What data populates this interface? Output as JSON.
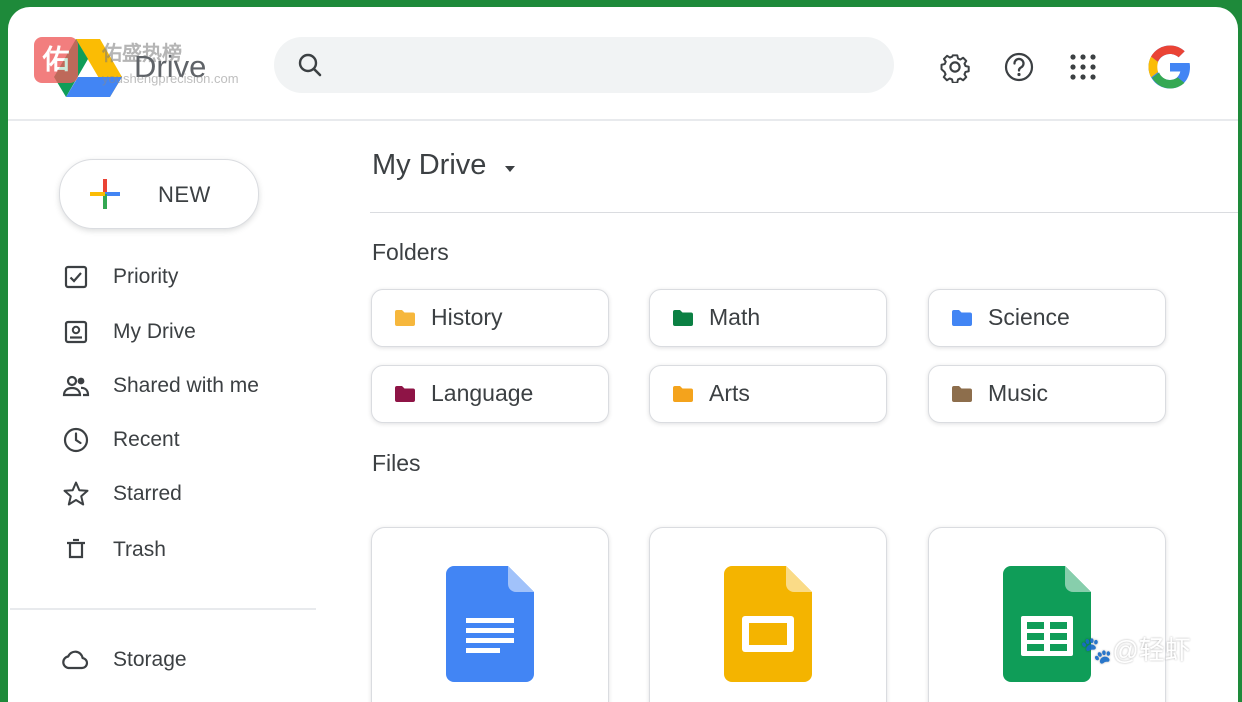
{
  "app": {
    "name": "Drive"
  },
  "watermark": {
    "badge": "佑",
    "title": "佑盛热榜",
    "url": "youshengprecision.com",
    "corner": "🐾@轻虾"
  },
  "search": {
    "placeholder": "",
    "value": ""
  },
  "header_icons": [
    "settings-gear-icon",
    "help-icon",
    "apps-grid-icon",
    "google-account-icon"
  ],
  "new_button": {
    "label": "NEW"
  },
  "nav": {
    "items": [
      {
        "label": "Priority",
        "icon": "priority-checkbox-icon"
      },
      {
        "label": "My Drive",
        "icon": "my-drive-icon"
      },
      {
        "label": "Shared with me",
        "icon": "shared-people-icon"
      },
      {
        "label": "Recent",
        "icon": "clock-icon"
      },
      {
        "label": "Starred",
        "icon": "star-icon"
      },
      {
        "label": "Trash",
        "icon": "trash-icon"
      }
    ],
    "storage": {
      "label": "Storage",
      "icon": "cloud-icon"
    }
  },
  "main": {
    "title": "My Drive",
    "folders_heading": "Folders",
    "folders": [
      {
        "label": "History",
        "color": "#f6b73c"
      },
      {
        "label": "Math",
        "color": "#0b8043"
      },
      {
        "label": "Science",
        "color": "#4285f4"
      },
      {
        "label": "Language",
        "color": "#8e1446"
      },
      {
        "label": "Arts",
        "color": "#f4a31c"
      },
      {
        "label": "Music",
        "color": "#8d6e4c"
      }
    ],
    "files_heading": "Files",
    "files": [
      {
        "type": "docs",
        "icon": "google-docs-icon",
        "color": "#4285f4"
      },
      {
        "type": "slides",
        "icon": "google-slides-icon",
        "color": "#f4b400"
      },
      {
        "type": "sheets",
        "icon": "google-sheets-icon",
        "color": "#0f9d58"
      }
    ]
  },
  "colors": {
    "frame": "#1e8a3a",
    "text": "#3c4043",
    "google_blue": "#4285f4",
    "google_red": "#ea4335",
    "google_yellow": "#fbbc05",
    "google_green": "#34a853"
  }
}
